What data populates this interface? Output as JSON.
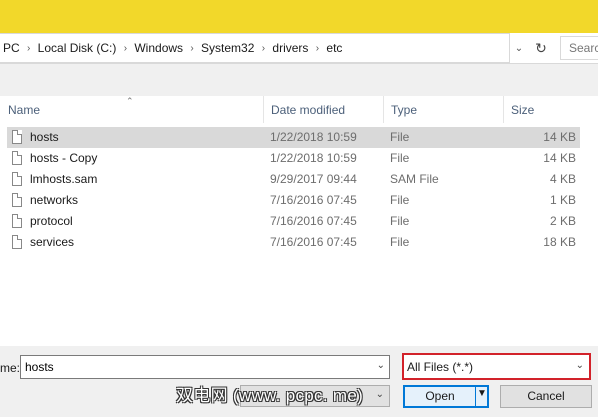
{
  "address_bar": {
    "crumbs": [
      "PC",
      "Local Disk (C:)",
      "Windows",
      "System32",
      "drivers",
      "etc"
    ],
    "search_placeholder": "Searc"
  },
  "columns": {
    "name": "Name",
    "date_modified": "Date modified",
    "type": "Type",
    "size": "Size"
  },
  "files": [
    {
      "name": "hosts",
      "date": "1/22/2018 10:59",
      "type": "File",
      "size": "14 KB",
      "selected": true
    },
    {
      "name": "hosts - Copy",
      "date": "1/22/2018 10:59",
      "type": "File",
      "size": "14 KB"
    },
    {
      "name": "lmhosts.sam",
      "date": "9/29/2017 09:44",
      "type": "SAM File",
      "size": "4 KB"
    },
    {
      "name": "networks",
      "date": "7/16/2016 07:45",
      "type": "File",
      "size": "1 KB"
    },
    {
      "name": "protocol",
      "date": "7/16/2016 07:45",
      "type": "File",
      "size": "2 KB"
    },
    {
      "name": "services",
      "date": "7/16/2016 07:45",
      "type": "File",
      "size": "18 KB"
    }
  ],
  "footer": {
    "filename_label": "me:",
    "filename_value": "hosts",
    "filter_label": "All Files  (*.*)",
    "open_label": "Open",
    "cancel_label": "Cancel",
    "watermark": "双电网 (www. pcpc. me)"
  },
  "colors": {
    "titlebar": "#f2d82a",
    "selected_row": "#d9d9d9",
    "filter_highlight": "#d2222a",
    "open_border": "#0078d7"
  }
}
